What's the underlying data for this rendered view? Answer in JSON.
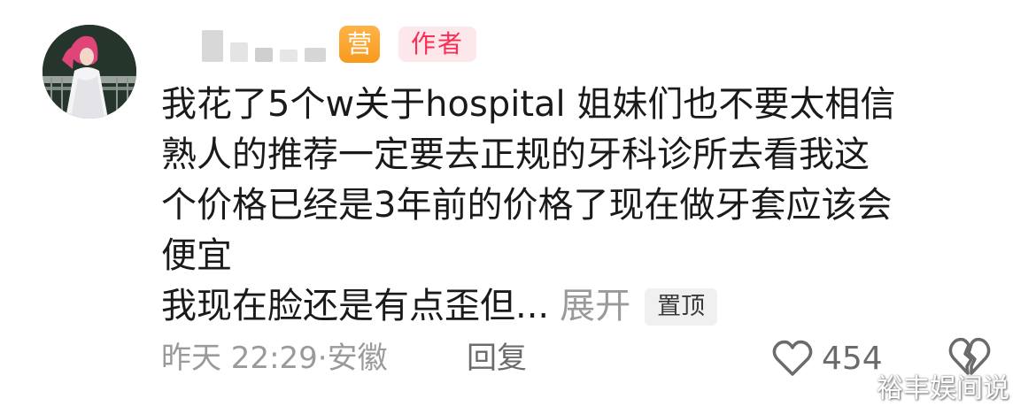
{
  "comment": {
    "badge_business": "营",
    "badge_author": "作者",
    "lines": [
      "我花了5个w关于hospital 姐妹们也不要太相信",
      "熟人的推荐一定要去正规的牙科诊所去看我这",
      "个价格已经是3年前的价格了现在做牙套应该会",
      "便宜"
    ],
    "last_line": "我现在脸还是有点歪但...",
    "expand_label": "展开",
    "pinned_label": "置顶",
    "timestamp": "昨天 22:29",
    "separator": "·",
    "location": "安徽",
    "reply_label": "回复",
    "like_count": "454"
  },
  "watermark": "裕丰娱间说",
  "colors": {
    "author_badge_bg": "#fce7ea",
    "author_badge_text": "#fe2c55",
    "business_badge": "#f79a1e",
    "meta_text": "#9a9a9a"
  },
  "icons": {
    "like": "heart-outline-icon",
    "dislike": "broken-heart-icon"
  }
}
